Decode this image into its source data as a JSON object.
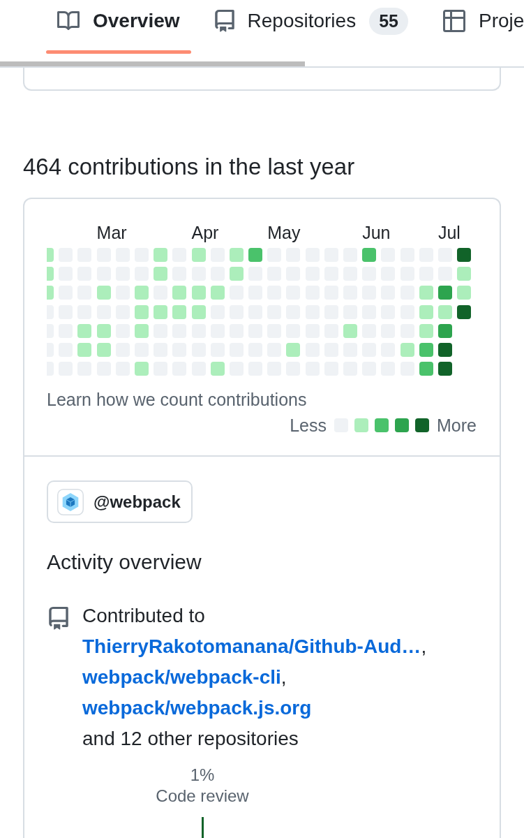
{
  "tabs": [
    {
      "label": "Overview",
      "selected": true
    },
    {
      "label": "Repositories",
      "counter": "55",
      "selected": false
    },
    {
      "label": "Proje",
      "selected": false
    }
  ],
  "contributions": {
    "title": "464 contributions in the last year",
    "weeks": [
      {
        "days": [
          {
            "color": "#aceebb"
          },
          {
            "color": "#aceebb"
          },
          {
            "color": "#aceebb"
          },
          {
            "color": "#eff2f5"
          },
          {
            "color": "#eff2f5"
          },
          {
            "color": "#eff2f5"
          },
          {
            "color": "#eff2f5"
          }
        ]
      },
      {
        "days": [
          {
            "color": "#eff2f5"
          },
          {
            "color": "#eff2f5"
          },
          {
            "color": "#eff2f5"
          },
          {
            "color": "#eff2f5"
          },
          {
            "color": "#eff2f5"
          },
          {
            "color": "#eff2f5"
          },
          {
            "color": "#eff2f5"
          }
        ]
      },
      {
        "days": [
          {
            "color": "#eff2f5"
          },
          {
            "color": "#eff2f5"
          },
          {
            "color": "#eff2f5"
          },
          {
            "color": "#eff2f5"
          },
          {
            "color": "#aceebb"
          },
          {
            "color": "#aceebb"
          },
          {
            "color": "#eff2f5"
          }
        ]
      },
      {
        "month": "Mar",
        "days": [
          {
            "color": "#eff2f5"
          },
          {
            "color": "#eff2f5"
          },
          {
            "color": "#aceebb"
          },
          {
            "color": "#eff2f5"
          },
          {
            "color": "#aceebb"
          },
          {
            "color": "#aceebb"
          },
          {
            "color": "#eff2f5"
          }
        ]
      },
      {
        "days": [
          {
            "color": "#eff2f5"
          },
          {
            "color": "#eff2f5"
          },
          {
            "color": "#eff2f5"
          },
          {
            "color": "#eff2f5"
          },
          {
            "color": "#eff2f5"
          },
          {
            "color": "#eff2f5"
          },
          {
            "color": "#eff2f5"
          }
        ]
      },
      {
        "days": [
          {
            "color": "#eff2f5"
          },
          {
            "color": "#eff2f5"
          },
          {
            "color": "#aceebb"
          },
          {
            "color": "#aceebb"
          },
          {
            "color": "#aceebb"
          },
          {
            "color": "#eff2f5"
          },
          {
            "color": "#aceebb"
          }
        ]
      },
      {
        "days": [
          {
            "color": "#aceebb"
          },
          {
            "color": "#aceebb"
          },
          {
            "color": "#eff2f5"
          },
          {
            "color": "#aceebb"
          },
          {
            "color": "#eff2f5"
          },
          {
            "color": "#eff2f5"
          },
          {
            "color": "#eff2f5"
          }
        ]
      },
      {
        "days": [
          {
            "color": "#eff2f5"
          },
          {
            "color": "#eff2f5"
          },
          {
            "color": "#aceebb"
          },
          {
            "color": "#aceebb"
          },
          {
            "color": "#eff2f5"
          },
          {
            "color": "#eff2f5"
          },
          {
            "color": "#eff2f5"
          }
        ]
      },
      {
        "month": "Apr",
        "days": [
          {
            "color": "#aceebb"
          },
          {
            "color": "#eff2f5"
          },
          {
            "color": "#aceebb"
          },
          {
            "color": "#aceebb"
          },
          {
            "color": "#eff2f5"
          },
          {
            "color": "#eff2f5"
          },
          {
            "color": "#eff2f5"
          }
        ]
      },
      {
        "days": [
          {
            "color": "#eff2f5"
          },
          {
            "color": "#eff2f5"
          },
          {
            "color": "#aceebb"
          },
          {
            "color": "#eff2f5"
          },
          {
            "color": "#eff2f5"
          },
          {
            "color": "#eff2f5"
          },
          {
            "color": "#aceebb"
          }
        ]
      },
      {
        "days": [
          {
            "color": "#aceebb"
          },
          {
            "color": "#aceebb"
          },
          {
            "color": "#eff2f5"
          },
          {
            "color": "#eff2f5"
          },
          {
            "color": "#eff2f5"
          },
          {
            "color": "#eff2f5"
          },
          {
            "color": "#eff2f5"
          }
        ]
      },
      {
        "days": [
          {
            "color": "#4ac26b"
          },
          {
            "color": "#eff2f5"
          },
          {
            "color": "#eff2f5"
          },
          {
            "color": "#eff2f5"
          },
          {
            "color": "#eff2f5"
          },
          {
            "color": "#eff2f5"
          },
          {
            "color": "#eff2f5"
          }
        ]
      },
      {
        "month": "May",
        "days": [
          {
            "color": "#eff2f5"
          },
          {
            "color": "#eff2f5"
          },
          {
            "color": "#eff2f5"
          },
          {
            "color": "#eff2f5"
          },
          {
            "color": "#eff2f5"
          },
          {
            "color": "#eff2f5"
          },
          {
            "color": "#eff2f5"
          }
        ]
      },
      {
        "days": [
          {
            "color": "#eff2f5"
          },
          {
            "color": "#eff2f5"
          },
          {
            "color": "#eff2f5"
          },
          {
            "color": "#eff2f5"
          },
          {
            "color": "#eff2f5"
          },
          {
            "color": "#aceebb"
          },
          {
            "color": "#eff2f5"
          }
        ]
      },
      {
        "days": [
          {
            "color": "#eff2f5"
          },
          {
            "color": "#eff2f5"
          },
          {
            "color": "#eff2f5"
          },
          {
            "color": "#eff2f5"
          },
          {
            "color": "#eff2f5"
          },
          {
            "color": "#eff2f5"
          },
          {
            "color": "#eff2f5"
          }
        ]
      },
      {
        "days": [
          {
            "color": "#eff2f5"
          },
          {
            "color": "#eff2f5"
          },
          {
            "color": "#eff2f5"
          },
          {
            "color": "#eff2f5"
          },
          {
            "color": "#eff2f5"
          },
          {
            "color": "#eff2f5"
          },
          {
            "color": "#eff2f5"
          }
        ]
      },
      {
        "days": [
          {
            "color": "#eff2f5"
          },
          {
            "color": "#eff2f5"
          },
          {
            "color": "#eff2f5"
          },
          {
            "color": "#eff2f5"
          },
          {
            "color": "#aceebb"
          },
          {
            "color": "#eff2f5"
          },
          {
            "color": "#eff2f5"
          }
        ]
      },
      {
        "month": "Jun",
        "days": [
          {
            "color": "#4ac26b"
          },
          {
            "color": "#eff2f5"
          },
          {
            "color": "#eff2f5"
          },
          {
            "color": "#eff2f5"
          },
          {
            "color": "#eff2f5"
          },
          {
            "color": "#eff2f5"
          },
          {
            "color": "#eff2f5"
          }
        ]
      },
      {
        "days": [
          {
            "color": "#eff2f5"
          },
          {
            "color": "#eff2f5"
          },
          {
            "color": "#eff2f5"
          },
          {
            "color": "#eff2f5"
          },
          {
            "color": "#eff2f5"
          },
          {
            "color": "#eff2f5"
          },
          {
            "color": "#eff2f5"
          }
        ]
      },
      {
        "days": [
          {
            "color": "#eff2f5"
          },
          {
            "color": "#eff2f5"
          },
          {
            "color": "#eff2f5"
          },
          {
            "color": "#eff2f5"
          },
          {
            "color": "#eff2f5"
          },
          {
            "color": "#aceebb"
          },
          {
            "color": "#eff2f5"
          }
        ]
      },
      {
        "days": [
          {
            "color": "#eff2f5"
          },
          {
            "color": "#eff2f5"
          },
          {
            "color": "#aceebb"
          },
          {
            "color": "#aceebb"
          },
          {
            "color": "#aceebb"
          },
          {
            "color": "#4ac26b"
          },
          {
            "color": "#4ac26b"
          }
        ]
      },
      {
        "month": "Jul",
        "days": [
          {
            "color": "#eff2f5"
          },
          {
            "color": "#eff2f5"
          },
          {
            "color": "#2da44e"
          },
          {
            "color": "#aceebb"
          },
          {
            "color": "#2da44e"
          },
          {
            "color": "#116329"
          },
          {
            "color": "#116329"
          }
        ]
      },
      {
        "days": [
          {
            "color": "#116329"
          },
          {
            "color": "#aceebb"
          },
          {
            "color": "#aceebb"
          },
          {
            "color": "#116329"
          }
        ]
      }
    ],
    "learn_link": "Learn how we count contributions",
    "legend": {
      "less": "Less",
      "swatches": [
        {
          "color": "#eff2f5"
        },
        {
          "color": "#aceebb"
        },
        {
          "color": "#4ac26b"
        },
        {
          "color": "#2da44e"
        },
        {
          "color": "#116329"
        }
      ],
      "more": "More"
    }
  },
  "activity": {
    "org": "@webpack",
    "title": "Activity overview",
    "contributed": {
      "prefix": "Contributed to",
      "repos": [
        {
          "name": "ThierryRakotomanana/Github-Aud…",
          "trailing": ","
        },
        {
          "name": "webpack/webpack-cli",
          "trailing": ","
        },
        {
          "name": "webpack/webpack.js.org"
        }
      ],
      "suffix": "and 12 other repositories"
    },
    "graph": {
      "percent": "1%",
      "label": "Code review"
    }
  }
}
